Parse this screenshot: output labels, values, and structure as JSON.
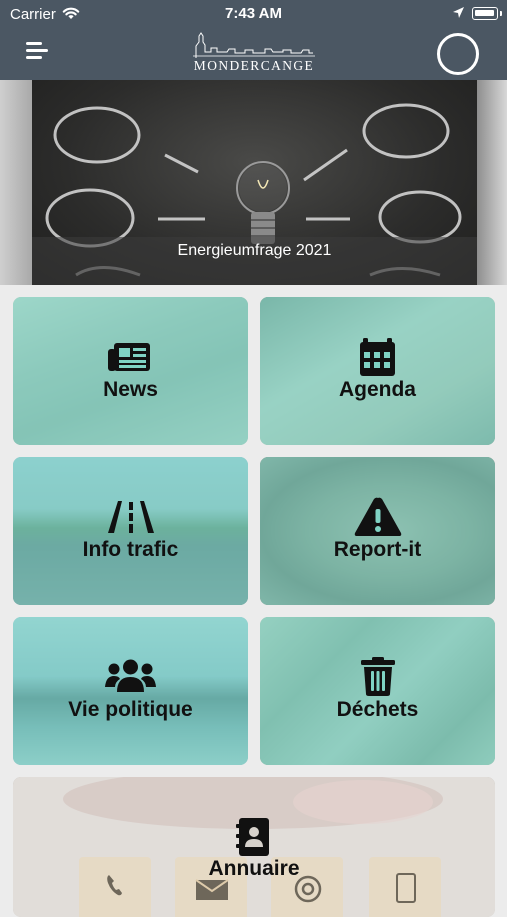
{
  "status_bar": {
    "carrier": "Carrier",
    "time": "7:43 AM"
  },
  "nav": {
    "logo_text": "MONDERCANGE"
  },
  "banner": {
    "caption": "Energieumfrage 2021"
  },
  "tiles": [
    {
      "label": "News",
      "icon": "newspaper-icon"
    },
    {
      "label": "Agenda",
      "icon": "calendar-icon"
    },
    {
      "label": "Info trafic",
      "icon": "road-icon"
    },
    {
      "label": "Report-it",
      "icon": "warning-icon"
    },
    {
      "label": "Vie politique",
      "icon": "users-icon"
    },
    {
      "label": "Déchets",
      "icon": "trash-icon"
    },
    {
      "label": "Annuaire",
      "icon": "address-book-icon"
    }
  ],
  "colors": {
    "header": "#4b5763",
    "tile_tint": "#7fd3c4",
    "background": "#ececec"
  }
}
